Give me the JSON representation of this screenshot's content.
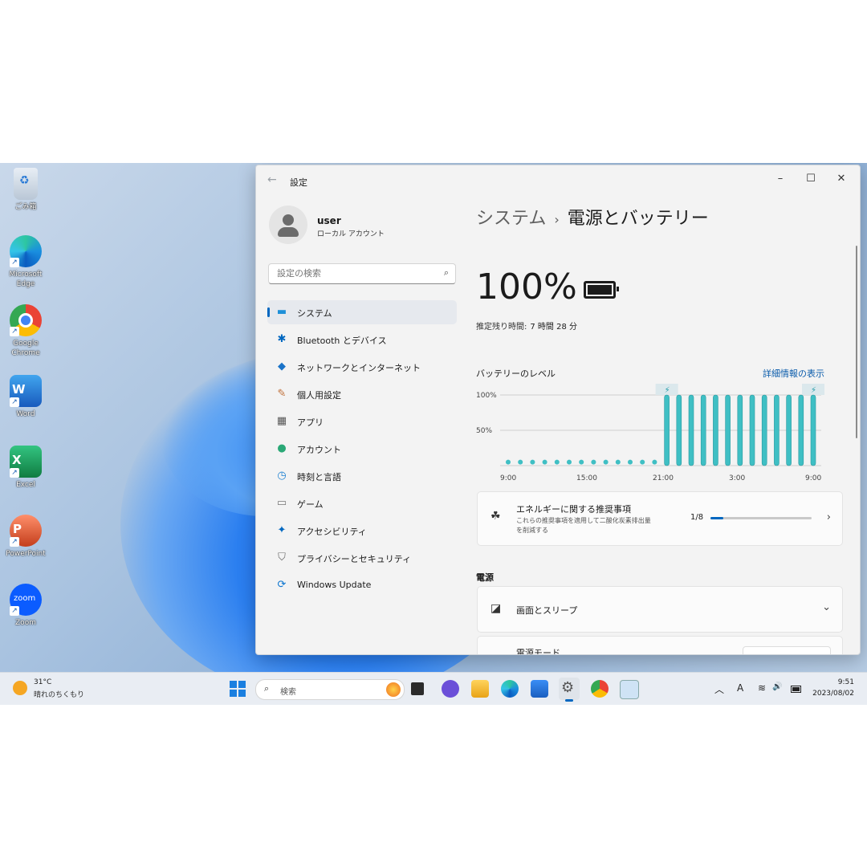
{
  "desktop": {
    "icons": [
      {
        "label": "ごみ箱",
        "icon": "recycle-bin-icon"
      },
      {
        "label": "Microsoft Edge",
        "icon": "edge-icon"
      },
      {
        "label": "Google Chrome",
        "icon": "chrome-icon"
      },
      {
        "label": "Word",
        "icon": "word-icon",
        "letter": "W"
      },
      {
        "label": "Excel",
        "icon": "excel-icon",
        "letter": "X"
      },
      {
        "label": "PowerPoint",
        "icon": "powerpoint-icon",
        "letter": "P"
      },
      {
        "label": "Zoom",
        "icon": "zoom-icon",
        "letter": "zoom"
      }
    ]
  },
  "window": {
    "title": "設定",
    "back": "←",
    "minimize": "–",
    "maximize": "☐",
    "close": "✕"
  },
  "profile": {
    "name": "user",
    "type": "ローカル アカウント"
  },
  "search": {
    "placeholder": "設定の検索",
    "icon": "⌕"
  },
  "nav": {
    "items": [
      {
        "label": "システム",
        "icon": "▬",
        "color": "#1e90d8",
        "active": true
      },
      {
        "label": "Bluetooth とデバイス",
        "icon": "✱",
        "color": "#0067c0"
      },
      {
        "label": "ネットワークとインターネット",
        "icon": "◆",
        "color": "#1a73c8"
      },
      {
        "label": "個人用設定",
        "icon": "✎",
        "color": "#c0703a"
      },
      {
        "label": "アプリ",
        "icon": "▦",
        "color": "#555555"
      },
      {
        "label": "アカウント",
        "icon": "●",
        "color": "#2aa876"
      },
      {
        "label": "時刻と言語",
        "icon": "◷",
        "color": "#1a7fd0"
      },
      {
        "label": "ゲーム",
        "icon": "▭",
        "color": "#777777"
      },
      {
        "label": "アクセシビリティ",
        "icon": "✦",
        "color": "#0067c0"
      },
      {
        "label": "プライバシーとセキュリティ",
        "icon": "⛉",
        "color": "#666666"
      },
      {
        "label": "Windows Update",
        "icon": "⟳",
        "color": "#0a74cf"
      }
    ]
  },
  "content": {
    "breadcrumb_parent": "システム",
    "breadcrumb_sep": "›",
    "breadcrumb_current": "電源とバッテリー",
    "battery_percent": "100%",
    "remaining_label": "推定残り時間:",
    "remaining_value": "7 時間 28 分",
    "level_title": "バッテリーのレベル",
    "details_link": "詳細情報の表示",
    "energy": {
      "title": "エネルギーに関する推奨事項",
      "desc1": "これらの推奨事項を適用して二酸化炭素排出量",
      "desc2": "を削減する",
      "progress_label": "1/8",
      "progress": 0.125,
      "icon": "☘",
      "chev": "›"
    },
    "power_section": "電源",
    "screen_sleep": {
      "label": "画面とスリープ",
      "icon": "◪",
      "chev": "⌄"
    },
    "power_mode": {
      "label": "電源モード"
    }
  },
  "chart_data": {
    "type": "bar",
    "ylabel_ticks": [
      "100%",
      "50%"
    ],
    "x_ticks": [
      "9:00",
      "15:00",
      "21:00",
      "3:00",
      "9:00"
    ],
    "ylim": [
      0,
      100
    ],
    "values": [
      5,
      5,
      5,
      5,
      5,
      5,
      5,
      5,
      5,
      5,
      5,
      5,
      5,
      100,
      100,
      100,
      100,
      100,
      100,
      100,
      100,
      100,
      100,
      100,
      100,
      100
    ],
    "charging_markers": [
      13,
      25
    ],
    "accent": "#3fbfc4"
  },
  "taskbar": {
    "weather_temp": "31°C",
    "weather_desc": "晴れのちくもり",
    "search_text": "検索",
    "search_icon": "⌕",
    "tray_chevron": "︿",
    "tray_ime": "A",
    "tray_wifi": "≋",
    "tray_volume": "🔊",
    "time": "9:51",
    "date": "2023/08/02"
  }
}
